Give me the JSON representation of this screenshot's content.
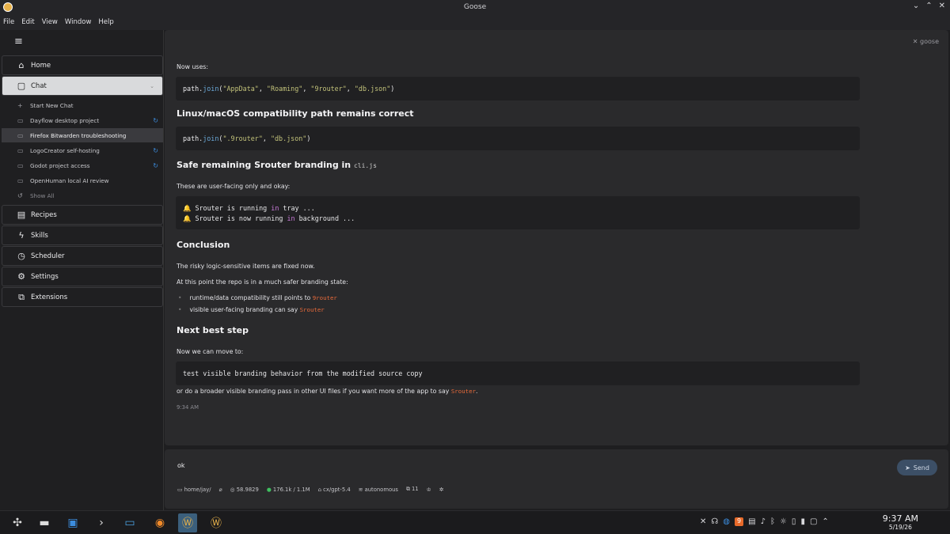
{
  "window": {
    "title": "Goose"
  },
  "menu": [
    "File",
    "Edit",
    "View",
    "Window",
    "Help"
  ],
  "sidebar": {
    "nav_top": [
      {
        "label": "Home",
        "icon": "home-icon"
      },
      {
        "label": "Chat",
        "icon": "chat-icon"
      }
    ],
    "chats": [
      {
        "label": "Start New Chat",
        "icon": "plus-icon"
      },
      {
        "label": "Dayflow desktop project",
        "icon": "chat-bubble-icon"
      },
      {
        "label": "Firefox Bitwarden troubleshooting",
        "icon": "chat-bubble-icon"
      },
      {
        "label": "LogoCreator self-hosting",
        "icon": "chat-bubble-icon"
      },
      {
        "label": "Godot project access",
        "icon": "chat-bubble-icon"
      },
      {
        "label": "OpenHuman local AI review",
        "icon": "chat-bubble-icon"
      },
      {
        "label": "Show All",
        "icon": "history-icon"
      }
    ],
    "nav_bottom": [
      {
        "label": "Recipes",
        "icon": "file-icon"
      },
      {
        "label": "Skills",
        "icon": "bolt-icon"
      },
      {
        "label": "Scheduler",
        "icon": "clock-icon"
      },
      {
        "label": "Settings",
        "icon": "gear-icon"
      },
      {
        "label": "Extensions",
        "icon": "puzzle-icon"
      }
    ]
  },
  "brand": "goose",
  "message": {
    "now_uses": "Now uses:",
    "code1": {
      "p1": "path.",
      "fn": "join",
      "p2": "(",
      "s1": "\"AppData\"",
      "c": ", ",
      "s2": "\"Roaming\"",
      "s3": "\"9router\"",
      "s4": "\"db.json\"",
      "end": ")"
    },
    "h1": "Linux/macOS compatibility path remains correct",
    "code2": {
      "p1": "path.",
      "fn": "join",
      "p2": "(",
      "s1": "\".9router\"",
      "c": ", ",
      "s2": "\"db.json\"",
      "end": ")"
    },
    "h2_text": "Safe remaining Srouter branding in ",
    "h2_code": "cli.js",
    "p_user": "These are user-facing only and okay:",
    "code3": {
      "l1a": "🔔 Srouter is running ",
      "l1kw": "in",
      "l1b": " tray ...",
      "l2a": "🔔 Srouter is now running ",
      "l2kw": "in",
      "l2b": " background ..."
    },
    "h3": "Conclusion",
    "p_fixed": "The risky logic-sensitive items are fixed now.",
    "p_state": "At this point the repo is in a much safer branding state:",
    "b1_text": "runtime/data compatibility still points to ",
    "b1_code": "9router",
    "b2_text": "visible user-facing branding can say ",
    "b2_code": "Srouter",
    "h4": "Next best step",
    "p_move": "Now we can move to:",
    "code4": "test visible branding behavior from the modified source copy",
    "p_final_a": "or do a broader visible branding pass in other UI files if you want more of the app to say ",
    "p_final_code": "Srouter",
    "p_final_b": ".",
    "time": "9:34 AM"
  },
  "composer": {
    "value": "ok",
    "send": "Send"
  },
  "status": {
    "dir": "home/jay/",
    "cost": "58.9829",
    "tokens": "176.1k / 1.1M",
    "model": "cx/gpt-5.4",
    "mode": "autonomous",
    "count": "11"
  },
  "taskbar": {
    "time": "9:37 AM",
    "date": "5/19/26",
    "badge": "9"
  }
}
